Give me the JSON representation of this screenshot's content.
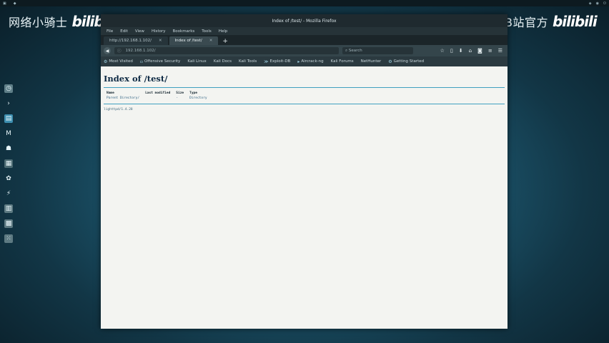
{
  "watermark": {
    "left_text": "网络小骑士",
    "left_logo": "bilibili",
    "right_text": "网络安全B站官方",
    "right_logo": "bilibili"
  },
  "dock": {
    "icons": [
      "clock-icon",
      "terminal-icon",
      "folder-icon",
      "metasploit-icon",
      "user-icon",
      "grid-icon",
      "burp-icon",
      "tool-icon",
      "settings-icon",
      "apps-icon",
      "apps-icon-2"
    ]
  },
  "window": {
    "title": "Index of /test/ - Mozilla Firefox",
    "menu": [
      "File",
      "Edit",
      "View",
      "History",
      "Bookmarks",
      "Tools",
      "Help"
    ],
    "tabs": [
      {
        "label": "http://192.168.1.102/"
      },
      {
        "label": "Index of /test/"
      }
    ],
    "url": "192.168.1.102/",
    "search_placeholder": "Search",
    "bookmarks": [
      "Most Visited",
      "Offensive Security",
      "Kali Linux",
      "Kali Docs",
      "Kali Tools",
      "Exploit-DB",
      "Aircrack-ng",
      "Kali Forums",
      "NetHunter",
      "Getting Started"
    ]
  },
  "page": {
    "heading": "Index of /test/",
    "columns": [
      "Name",
      "Last modified",
      "Size",
      "Type"
    ],
    "rows": [
      {
        "name": "Parent Directory/",
        "modified": "",
        "size": "-",
        "type": "Directory"
      }
    ],
    "address": "lighttpd/1.4.28"
  },
  "colors": {
    "accent": "#3fa0c0",
    "heading": "#0e2a44",
    "link": "#2b5f80"
  }
}
